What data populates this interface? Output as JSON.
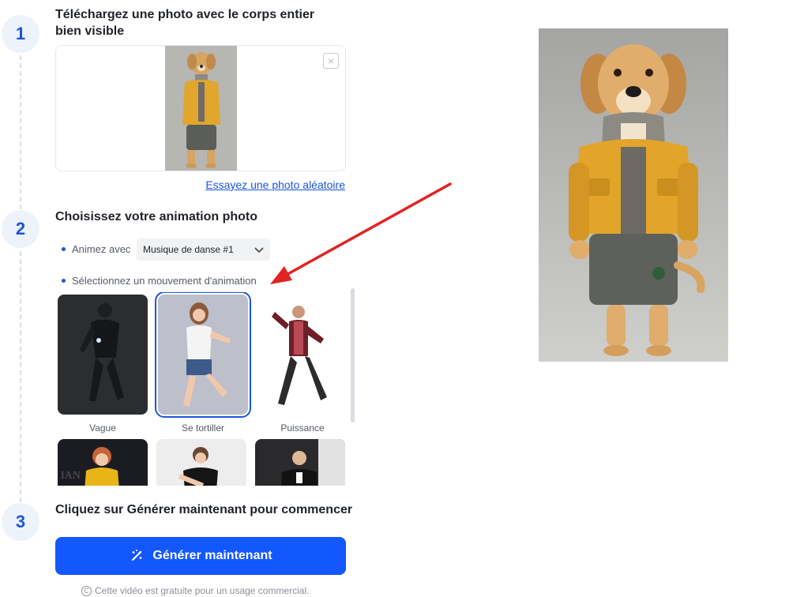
{
  "steps": [
    {
      "number": "1",
      "title": "Téléchargez une photo avec le corps entier bien visible"
    },
    {
      "number": "2",
      "title": "Choisissez votre animation photo"
    },
    {
      "number": "3",
      "title": "Cliquez sur Générer maintenant pour commencer"
    }
  ],
  "upload": {
    "random_link": "Essayez une photo aléatoire"
  },
  "animation": {
    "animate_with_label": "Animez avec",
    "music_selected": "Musique de danse #1",
    "select_movement_label": "Sélectionnez un mouvement d'animation",
    "cards": [
      {
        "label": "Vague",
        "icon": "figure-thumbnail"
      },
      {
        "label": "Se tortiller",
        "icon": "figure-thumbnail",
        "selected": true
      },
      {
        "label": "Puissance",
        "icon": "figure-thumbnail"
      },
      {
        "label": "",
        "icon": "figure-thumbnail"
      },
      {
        "label": "",
        "icon": "figure-thumbnail"
      },
      {
        "label": "",
        "icon": "figure-thumbnail"
      }
    ]
  },
  "generate": {
    "button_label": "Générer maintenant",
    "footnote": "Cette vidéo est gratuite pour un usage commercial."
  },
  "colors": {
    "accent": "#1357ff",
    "link": "#1a56db",
    "arrow": "#e02424"
  }
}
